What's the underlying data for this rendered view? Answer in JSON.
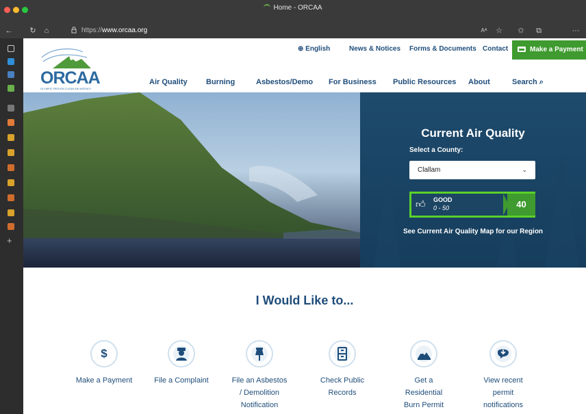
{
  "browser": {
    "tab_title": "Home - ORCAA",
    "url_prefix": "https://",
    "url_host": "www.orcaa.org",
    "more_label": "···"
  },
  "site": {
    "logo_text": "ORCAA",
    "logo_tagline": "OLYMPIC REGION CLEAN AIR AGENCY",
    "utility_nav": [
      {
        "label": "English"
      },
      {
        "label": "News & Notices"
      },
      {
        "label": "Forms & Documents"
      },
      {
        "label": "Contact"
      }
    ],
    "payment_button": "Make a Payment",
    "main_nav": [
      {
        "label": "Air Quality"
      },
      {
        "label": "Burning"
      },
      {
        "label": "Asbestos/Demo"
      },
      {
        "label": "For Business"
      },
      {
        "label": "Public Resources"
      },
      {
        "label": "About"
      },
      {
        "label": "Search"
      }
    ]
  },
  "air_quality": {
    "title": "Current Air Quality",
    "select_label": "Select a County:",
    "selected_county": "Clallam",
    "status": "GOOD",
    "range": "0 - 50",
    "aqi": "40",
    "map_link": "See Current Air Quality Map for our Region",
    "status_color": "#5bd12a"
  },
  "actions": {
    "heading": "I Would Like to...",
    "items": [
      {
        "label": "Make a Payment",
        "icon": "dollar-icon"
      },
      {
        "label": "File a Complaint",
        "icon": "officer-icon"
      },
      {
        "label": "File an Asbestos / Demolition Notification",
        "icon": "pushpin-icon"
      },
      {
        "label": "Check Public Records",
        "icon": "file-cabinet-icon"
      },
      {
        "label": "Get a Residential Burn Permit",
        "icon": "campfire-icon"
      },
      {
        "label": "View recent permit notifications",
        "icon": "download-icon"
      }
    ]
  },
  "colors": {
    "brand_blue": "#1f4d7a",
    "brand_green": "#3f9a2f",
    "hero_panel": "#1e4a6c"
  }
}
